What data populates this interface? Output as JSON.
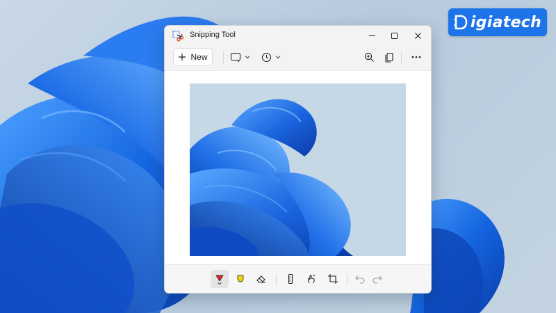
{
  "watermark": {
    "text": "igiatech",
    "letter_icon": "digiatech-d-logo-icon"
  },
  "window": {
    "title": "Snipping Tool",
    "app_icon": "snipping-tool-scissors-icon",
    "controls": [
      "minimize-icon",
      "maximize-icon",
      "close-icon"
    ]
  },
  "toolbar": {
    "new_label": "New",
    "new_icon": "plus-icon",
    "mode_icon": "snip-mode-rectangle-icon",
    "delay_icon": "clock-delay-icon",
    "zoom_icon": "zoom-in-icon",
    "share_icon": "copy-icon",
    "more_icon": "more-options-icon"
  },
  "markup_tools": [
    "ballpoint-pen-icon",
    "highlighter-icon",
    "eraser-icon",
    "ruler-icon",
    "touch-writing-icon",
    "crop-icon",
    "undo-icon",
    "redo-icon"
  ],
  "colors": {
    "window_bg": "#f3f3f3",
    "accent": "#1d74e8",
    "pen_red": "#e0242a",
    "highlighter_yellow": "#f5d300",
    "bloom_blue": "#1a5fd6"
  }
}
